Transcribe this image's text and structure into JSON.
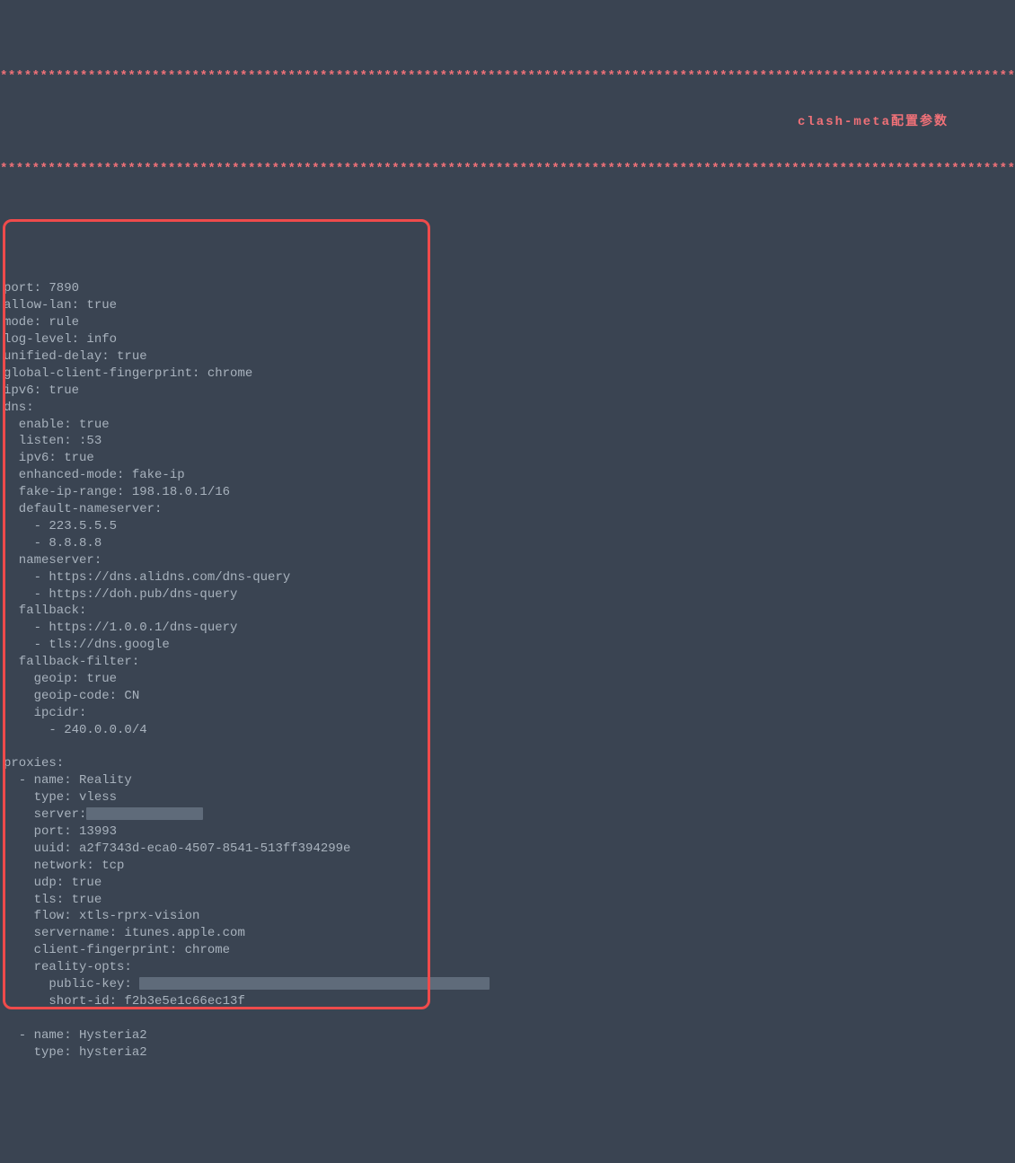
{
  "banner": {
    "stars": "*****************************************************************************************************************************************",
    "title": "clash-meta配置参数"
  },
  "config": {
    "l1": "port: 7890",
    "l2": "allow-lan: true",
    "l3": "mode: rule",
    "l4": "log-level: info",
    "l5": "unified-delay: true",
    "l6": "global-client-fingerprint: chrome",
    "l7": "ipv6: true",
    "l8": "dns:",
    "l9": "  enable: true",
    "l10": "  listen: :53",
    "l11": "  ipv6: true",
    "l12": "  enhanced-mode: fake-ip",
    "l13": "  fake-ip-range: 198.18.0.1/16",
    "l14": "  default-nameserver:",
    "l15": "    - 223.5.5.5",
    "l16": "    - 8.8.8.8",
    "l17": "  nameserver:",
    "l18": "    - https://dns.alidns.com/dns-query",
    "l19": "    - https://doh.pub/dns-query",
    "l20": "  fallback:",
    "l21": "    - https://1.0.0.1/dns-query",
    "l22": "    - tls://dns.google",
    "l23": "  fallback-filter:",
    "l24": "    geoip: true",
    "l25": "    geoip-code: CN",
    "l26": "    ipcidr:",
    "l27": "      - 240.0.0.0/4",
    "l28": "",
    "l29": "proxies:",
    "l30": "  - name: Reality",
    "l31": "    type: vless",
    "l32a": "    server:",
    "l33": "    port: 13993",
    "l34": "    uuid: a2f7343d-eca0-4507-8541-513ff394299e",
    "l35": "    network: tcp",
    "l36": "    udp: true",
    "l37": "    tls: true",
    "l38": "    flow: xtls-rprx-vision",
    "l39": "    servername: itunes.apple.com",
    "l40": "    client-fingerprint: chrome",
    "l41": "    reality-opts:",
    "l42a": "      public-key: ",
    "l43": "      short-id: f2b3e5e1c66ec13f",
    "l44": "",
    "l45": "  - name: Hysteria2",
    "l46": "    type: hysteria2"
  }
}
